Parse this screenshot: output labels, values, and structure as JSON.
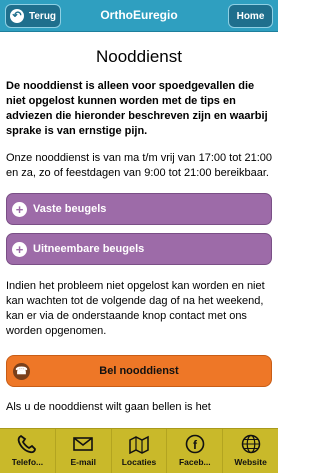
{
  "header": {
    "back_label": "Terug",
    "title": "OrthoEuregio",
    "home_label": "Home"
  },
  "page": {
    "title": "Nooddienst",
    "intro": "De nooddienst is alleen voor spoedgevallen die niet opgelost kunnen worden met de tips en adviezen die hieronder beschreven zijn en waarbij sprake is van ernstige pijn.",
    "hours": "Onze nooddienst is van ma t/m vrij van 17:00 tot 21:00 en za, zo of feestdagen van 9:00 tot 21:00 bereikbaar.",
    "sections": [
      {
        "label": "Vaste beugels"
      },
      {
        "label": "Uitneembare beugels"
      }
    ],
    "note": "Indien het probleem niet opgelost kan worden en niet kan wachten tot de volgende dag of na het weekend, kan er via de onderstaande knop contact met ons worden opgenomen.",
    "call_label": "Bel nooddienst",
    "footer_text": "Als u de nooddienst wilt gaan bellen is het"
  },
  "tabs": [
    {
      "label": "Telefo...",
      "icon": "phone-icon"
    },
    {
      "label": "E-mail",
      "icon": "envelope-icon"
    },
    {
      "label": "Locaties",
      "icon": "map-icon"
    },
    {
      "label": "Faceb...",
      "icon": "facebook-icon"
    },
    {
      "label": "Website",
      "icon": "globe-icon"
    }
  ],
  "colors": {
    "header": "#2f9fc0",
    "collapsible": "#9d6ba8",
    "call_button": "#ee7727",
    "tabbar": "#c9b92a"
  }
}
